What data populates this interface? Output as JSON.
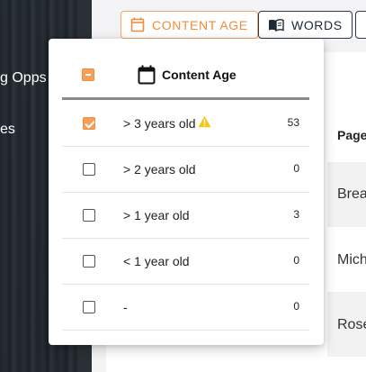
{
  "sidebar": {
    "items": [
      {
        "label": "g Opps"
      },
      {
        "label": "es"
      }
    ]
  },
  "toolbar": {
    "content_age_label": "CONTENT AGE",
    "words_label": "WORDS"
  },
  "table": {
    "header": "Page",
    "rows": [
      {
        "cell": "Brea"
      },
      {
        "cell": "Mich"
      },
      {
        "cell": "Rose"
      }
    ]
  },
  "popup": {
    "title": "Content Age",
    "header_checkbox_state": "indeterminate",
    "options": [
      {
        "label": "> 3 years old",
        "count": "53",
        "checked": true,
        "warning": true
      },
      {
        "label": "> 2 years old",
        "count": "0",
        "checked": false,
        "warning": false
      },
      {
        "label": "> 1 year old",
        "count": "3",
        "checked": false,
        "warning": false
      },
      {
        "label": "< 1 year old",
        "count": "0",
        "checked": false,
        "warning": false
      },
      {
        "label": "-",
        "count": "0",
        "checked": false,
        "warning": false
      }
    ]
  },
  "colors": {
    "accent": "#f08c3c",
    "accent_fill": "#f5a05a",
    "warning": "#f5c518",
    "dark": "#1e2a36"
  }
}
